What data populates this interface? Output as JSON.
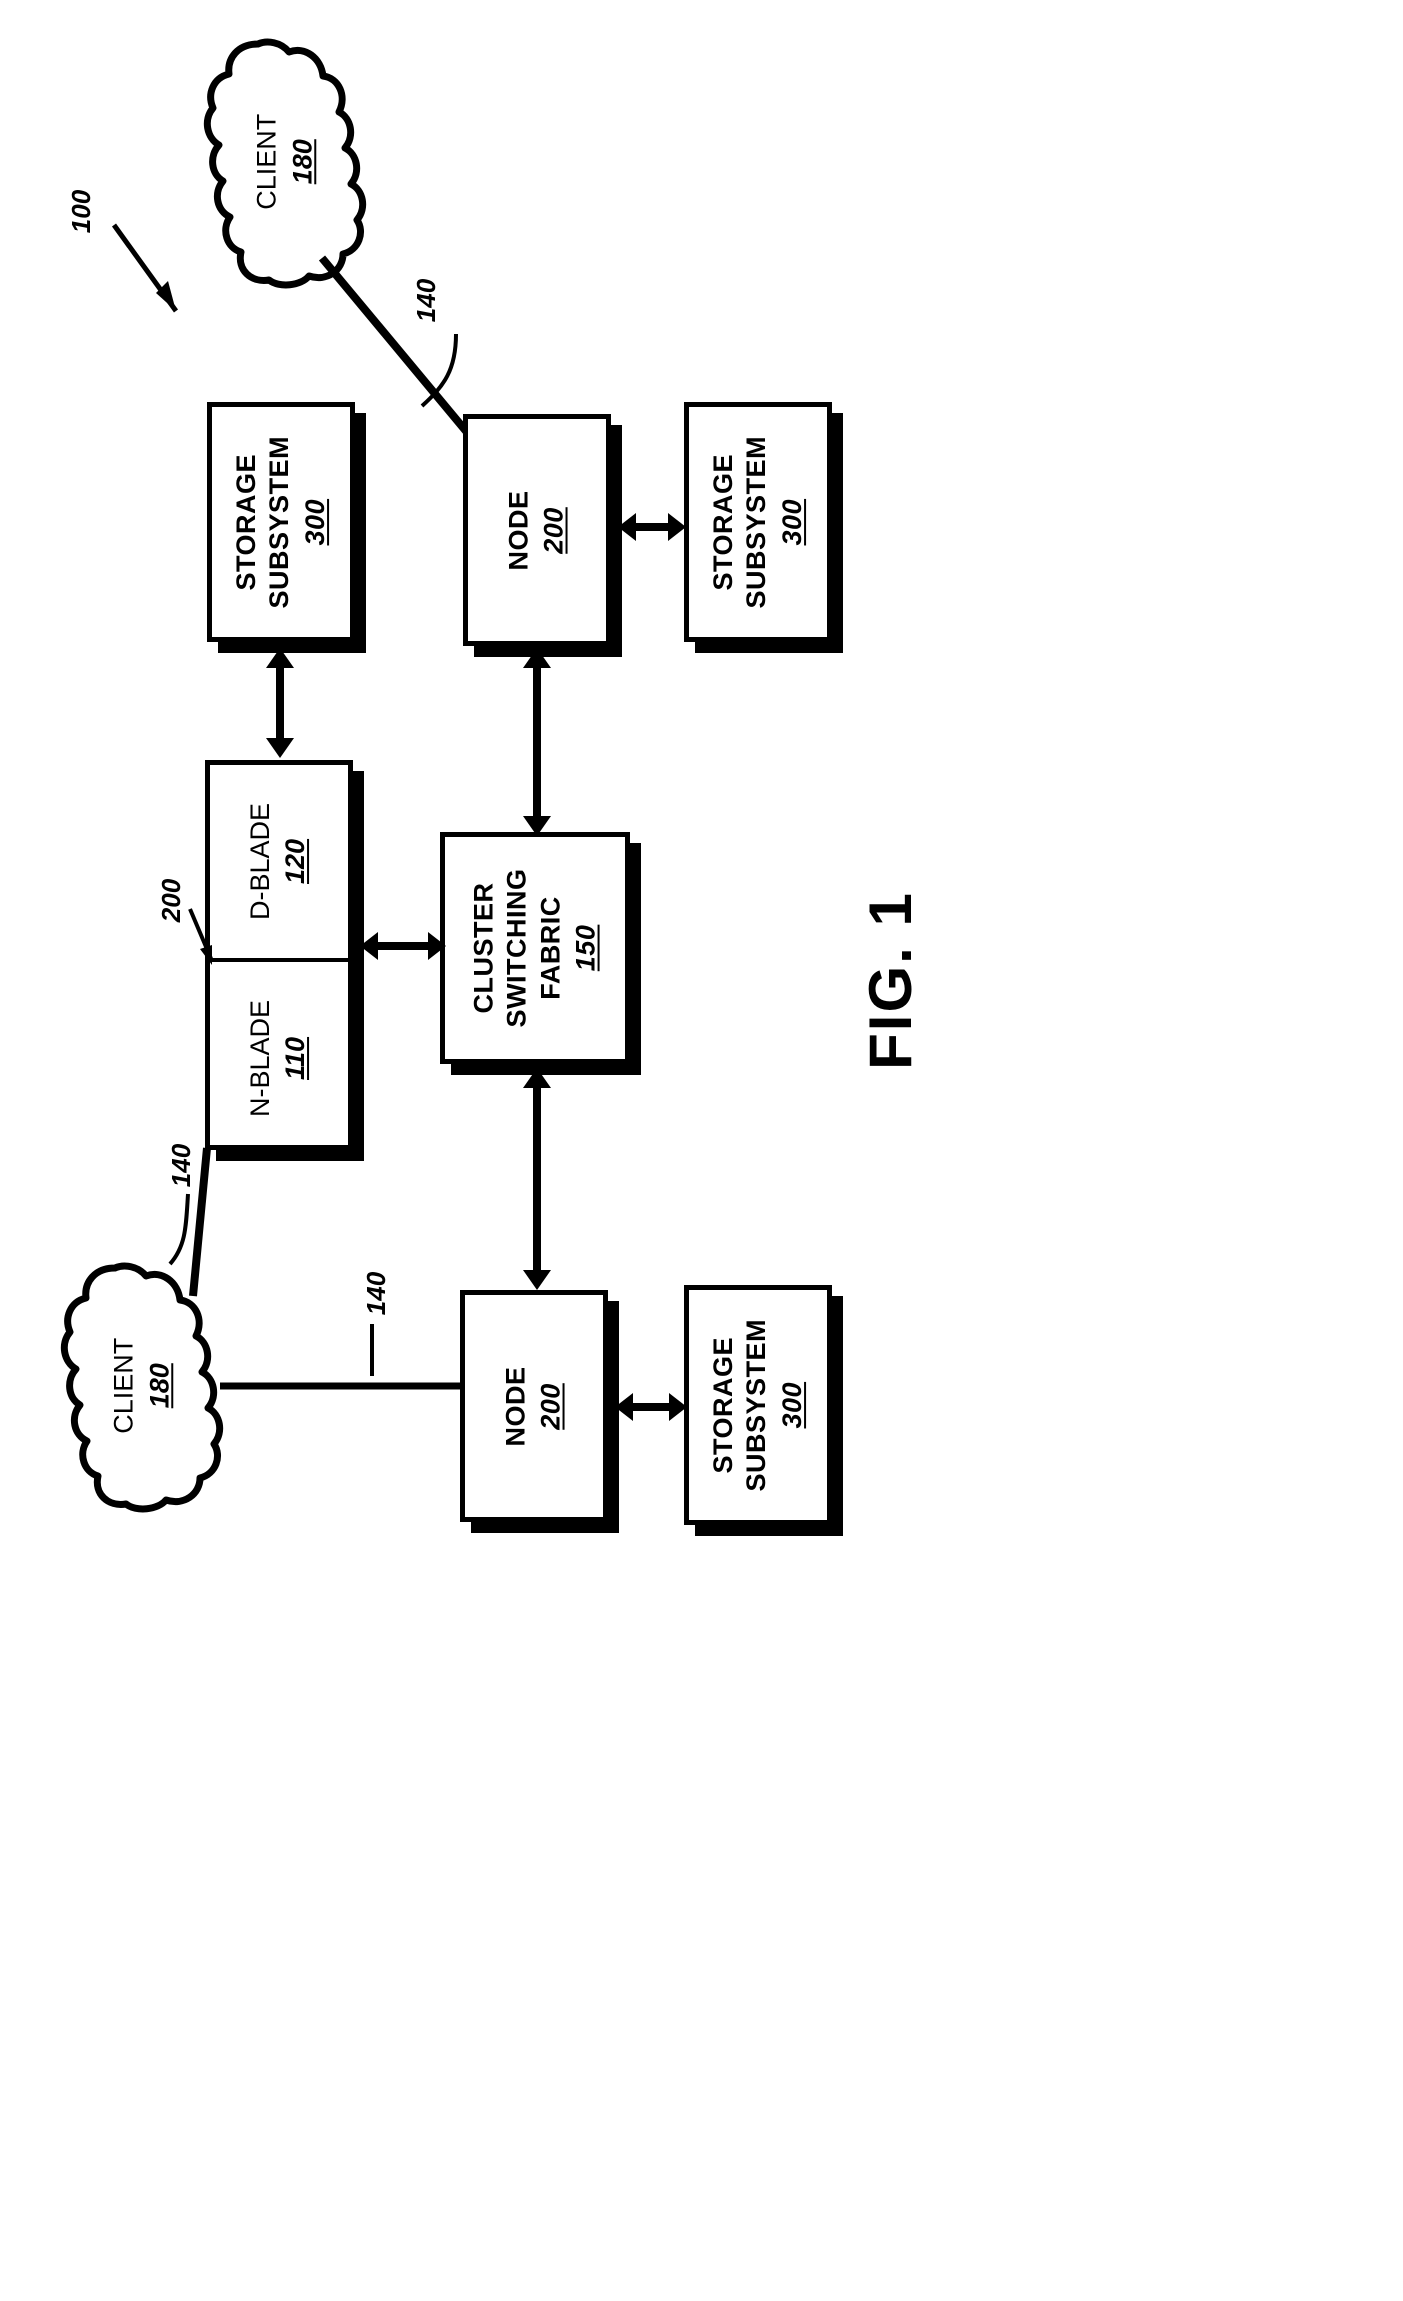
{
  "figure": {
    "caption": "FIG. 1",
    "system_ref": "100",
    "orientation": "landscape-rotated-90ccw"
  },
  "nodes": {
    "client_top": {
      "label": "CLIENT",
      "ref": "180",
      "shape": "cloud"
    },
    "client_bottom": {
      "label": "CLIENT",
      "ref": "180",
      "shape": "cloud"
    },
    "storage_top_left": {
      "label_line1": "STORAGE",
      "label_line2": "SUBSYSTEM",
      "ref": "300",
      "shape": "box"
    },
    "storage_top_right": {
      "label_line1": "STORAGE",
      "label_line2": "SUBSYSTEM",
      "ref": "300",
      "shape": "box"
    },
    "storage_bottom_right": {
      "label_line1": "STORAGE",
      "label_line2": "SUBSYSTEM",
      "ref": "300",
      "shape": "box"
    },
    "node_top_right": {
      "label": "NODE",
      "ref": "200",
      "shape": "box"
    },
    "node_bottom": {
      "label": "NODE",
      "ref": "200",
      "shape": "box"
    },
    "node_detail": {
      "ref": "200",
      "n_blade": {
        "label": "N-BLADE",
        "ref": "110"
      },
      "d_blade": {
        "label": "D-BLADE",
        "ref": "120"
      }
    },
    "cluster_fabric": {
      "label_line1": "CLUSTER",
      "label_line2": "SWITCHING",
      "label_line3": "FABRIC",
      "ref": "150",
      "shape": "box"
    }
  },
  "connections": [
    {
      "from": "client_top",
      "to": "node_top_right",
      "ref": "140",
      "style": "line"
    },
    {
      "from": "client_bottom",
      "to": "node_detail",
      "ref": "140",
      "style": "line"
    },
    {
      "from": "client_bottom",
      "to": "node_bottom",
      "ref": "140",
      "style": "line"
    },
    {
      "from": "node_detail",
      "to": "storage_top_left",
      "style": "double-arrow"
    },
    {
      "from": "node_detail",
      "to": "cluster_fabric",
      "style": "double-arrow"
    },
    {
      "from": "cluster_fabric",
      "to": "node_top_right",
      "style": "double-arrow"
    },
    {
      "from": "cluster_fabric",
      "to": "node_bottom",
      "style": "double-arrow"
    },
    {
      "from": "node_top_right",
      "to": "storage_top_right",
      "style": "double-arrow"
    },
    {
      "from": "node_bottom",
      "to": "storage_bottom_right",
      "style": "double-arrow"
    }
  ],
  "ref_labels": {
    "system": "100",
    "conn_top": "140",
    "conn_mid": "140",
    "conn_bottom": "140",
    "node_detail": "200"
  }
}
